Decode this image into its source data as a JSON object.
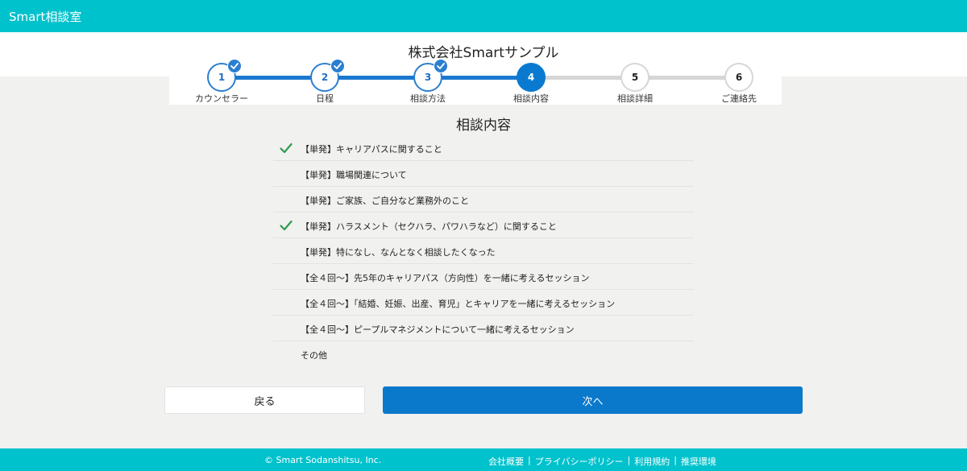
{
  "header": {
    "brand": "Smart相談室"
  },
  "company": {
    "name": "株式会社Smartサンプル"
  },
  "accent_colors": {
    "primary": "#0a7ad1",
    "teal": "#00c2cc",
    "check_green": "#2e9b4f"
  },
  "steps": [
    {
      "num": "1",
      "label": "カウンセラー",
      "state": "done"
    },
    {
      "num": "2",
      "label": "日程",
      "state": "done"
    },
    {
      "num": "3",
      "label": "相談方法",
      "state": "done"
    },
    {
      "num": "4",
      "label": "相談内容",
      "state": "current"
    },
    {
      "num": "5",
      "label": "相談詳細",
      "state": "todo"
    },
    {
      "num": "6",
      "label": "ご連絡先",
      "state": "todo"
    }
  ],
  "section": {
    "title": "相談内容"
  },
  "options": [
    {
      "text": "【単発】キャリアパスに関すること",
      "checked": true
    },
    {
      "text": "【単発】職場関連について",
      "checked": false
    },
    {
      "text": "【単発】ご家族、ご自分など業務外のこと",
      "checked": false
    },
    {
      "text": "【単発】ハラスメント（セクハラ、パワハラなど）に関すること",
      "checked": true
    },
    {
      "text": "【単発】特になし、なんとなく相談したくなった",
      "checked": false
    },
    {
      "text": "【全４回〜】先5年のキャリアパス（方向性）を一緒に考えるセッション",
      "checked": false
    },
    {
      "text": "【全４回〜】「結婚、妊娠、出産、育児」とキャリアを一緒に考えるセッション",
      "checked": false
    },
    {
      "text": "【全４回〜】ピープルマネジメントについて一緒に考えるセッション",
      "checked": false
    },
    {
      "text": "その他",
      "checked": false
    }
  ],
  "buttons": {
    "back": "戻る",
    "next": "次へ"
  },
  "footer": {
    "copyright": "© Smart Sodanshitsu, Inc.",
    "links": [
      "会社概要",
      "プライバシーポリシー",
      "利用規約",
      "推奨環境"
    ],
    "separator": "|"
  }
}
